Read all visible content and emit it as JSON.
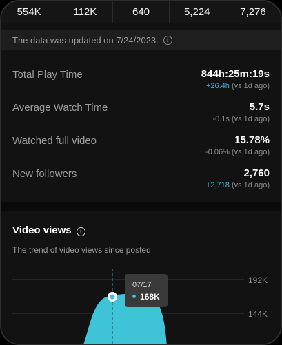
{
  "top_stats": [
    "554K",
    "112K",
    "640",
    "5,224",
    "7,276"
  ],
  "notice": {
    "text": "The data was updated on 7/24/2023.",
    "icon": "info-icon"
  },
  "metrics": [
    {
      "label": "Total Play Time",
      "value": "844h:25m:19s",
      "delta": "+26.4h",
      "delta_suffix": " (vs 1d ago)",
      "delta_positive": true
    },
    {
      "label": "Average Watch Time",
      "value": "5.7s",
      "delta": "-0.1s",
      "delta_suffix": " (vs 1d ago)",
      "delta_positive": false
    },
    {
      "label": "Watched full video",
      "value": "15.78%",
      "delta": "-0.06%",
      "delta_suffix": " (vs 1d ago)",
      "delta_positive": false
    },
    {
      "label": "New followers",
      "value": "2,760",
      "delta": "+2,718",
      "delta_suffix": " (vs 1d ago)",
      "delta_positive": true
    }
  ],
  "video_views": {
    "title": "Video views",
    "subtitle": "The trend of video views since posted"
  },
  "tooltip": {
    "date": "07/17",
    "value": "168K"
  },
  "colors": {
    "accent": "#3fc3d6",
    "positive_delta": "#3fb6d8"
  },
  "chart_data": {
    "type": "area",
    "y_ticks": [
      "192K",
      "144K"
    ],
    "y_tick_values": [
      192000,
      144000
    ],
    "highlight": {
      "x": "07/17",
      "y": 168000
    }
  }
}
